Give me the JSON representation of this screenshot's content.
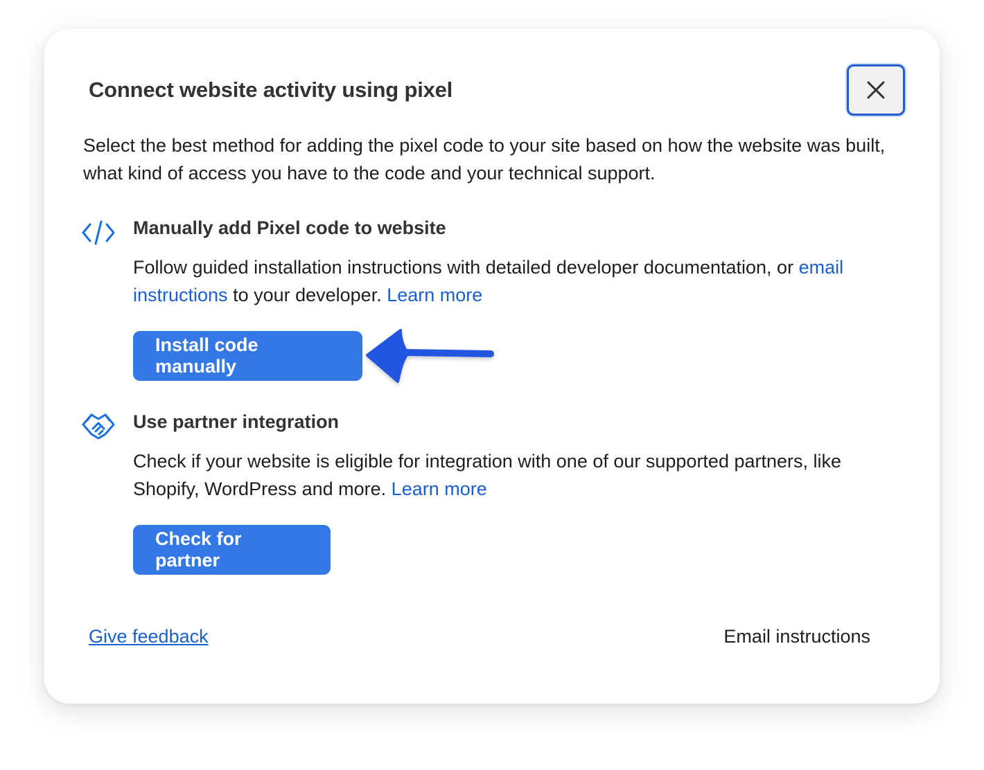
{
  "dialog": {
    "title": "Connect website activity using pixel",
    "description": "Select the best method for adding the pixel code to your site based on how the website was built, what kind of access you have to the code and your technical support.",
    "close_icon": "close-icon"
  },
  "manual": {
    "icon": "code-icon",
    "heading": "Manually add Pixel code to website",
    "text_before": "Follow guided installation instructions with detailed developer documentation, or ",
    "email_link": "email instructions",
    "text_middle": " to your developer. ",
    "learn_more": "Learn more",
    "button_label": "Install code manually"
  },
  "partner": {
    "icon": "handshake-icon",
    "heading": "Use partner integration",
    "text_before": "Check if your website is eligible for integration with one of our supported partners, like Shopify, WordPress and more. ",
    "learn_more": "Learn more",
    "button_label": "Check for partner"
  },
  "footer": {
    "feedback_link": "Give feedback",
    "email_button": "Email instructions"
  },
  "colors": {
    "accent": "#3478e6",
    "link": "#1a5fd1",
    "annotation_arrow": "#2456e0"
  }
}
